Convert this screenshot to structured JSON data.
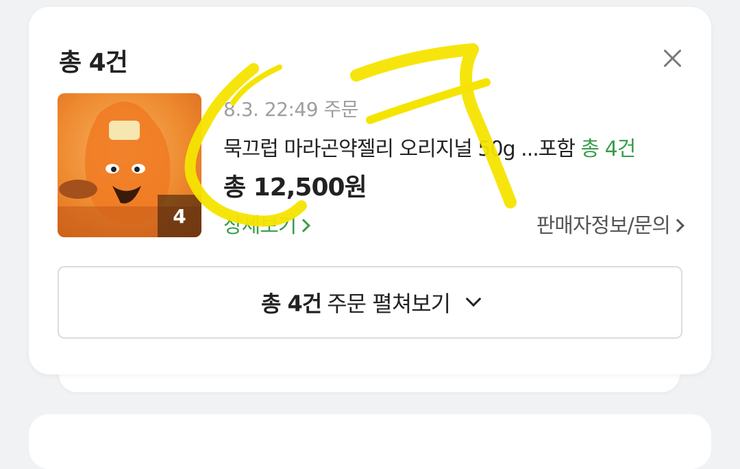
{
  "card": {
    "title": "총 4건",
    "order": {
      "date": "8.3. 22:49 주문",
      "product_name": "묵끄럽 마라곤약젤리 오리지널 50g ...포함",
      "product_count": "총 4건",
      "price": "총 12,500원",
      "thumbnail_count": "4",
      "detail_link": "상세보기",
      "seller_link": "판매자정보/문의"
    },
    "expand_button": {
      "bold_part": "총 4건",
      "rest": "주문 펼쳐보기"
    }
  },
  "colors": {
    "accent_green": "#3b9b4b",
    "annotation_yellow": "#f5e400"
  },
  "icons": {
    "close": "close-icon",
    "chevron_right": "chevron-right-icon",
    "chevron_down": "chevron-down-icon"
  }
}
